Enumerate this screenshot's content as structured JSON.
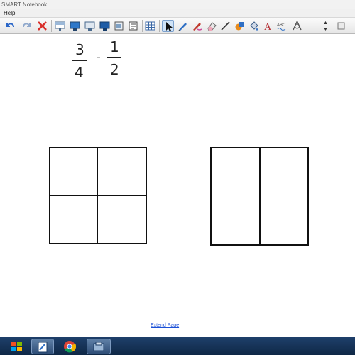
{
  "window": {
    "title": "SMART Notebook"
  },
  "menu": {
    "items": [
      "Help"
    ]
  },
  "toolbar": {
    "buttons": [
      "undo-icon",
      "redo-icon",
      "delete-icon",
      "screen-shade-icon",
      "display-icon",
      "display-2-icon",
      "presentation-icon",
      "capture-icon",
      "document-camera-icon",
      "table-icon",
      "select-icon",
      "pen-icon",
      "creative-pen-icon",
      "eraser-icon",
      "line-icon",
      "shapes-icon",
      "fill-icon",
      "text-icon",
      "handwriting-icon",
      "properties-icon",
      "move-icon"
    ],
    "text_tool_glyph": "A",
    "abc_glyph": "ABC"
  },
  "canvas": {
    "fraction_a": {
      "numerator": "3",
      "denominator": "4"
    },
    "operator": "-",
    "fraction_b": {
      "numerator": "1",
      "denominator": "2"
    },
    "shapes": [
      "square divided into 4 equal parts",
      "rectangle divided into 2 equal parts"
    ],
    "extend_page_label": "Extend Page"
  },
  "taskbar": {
    "items": [
      "start-icon",
      "notebook-app-icon",
      "chrome-icon",
      "smart-tools-icon"
    ]
  }
}
